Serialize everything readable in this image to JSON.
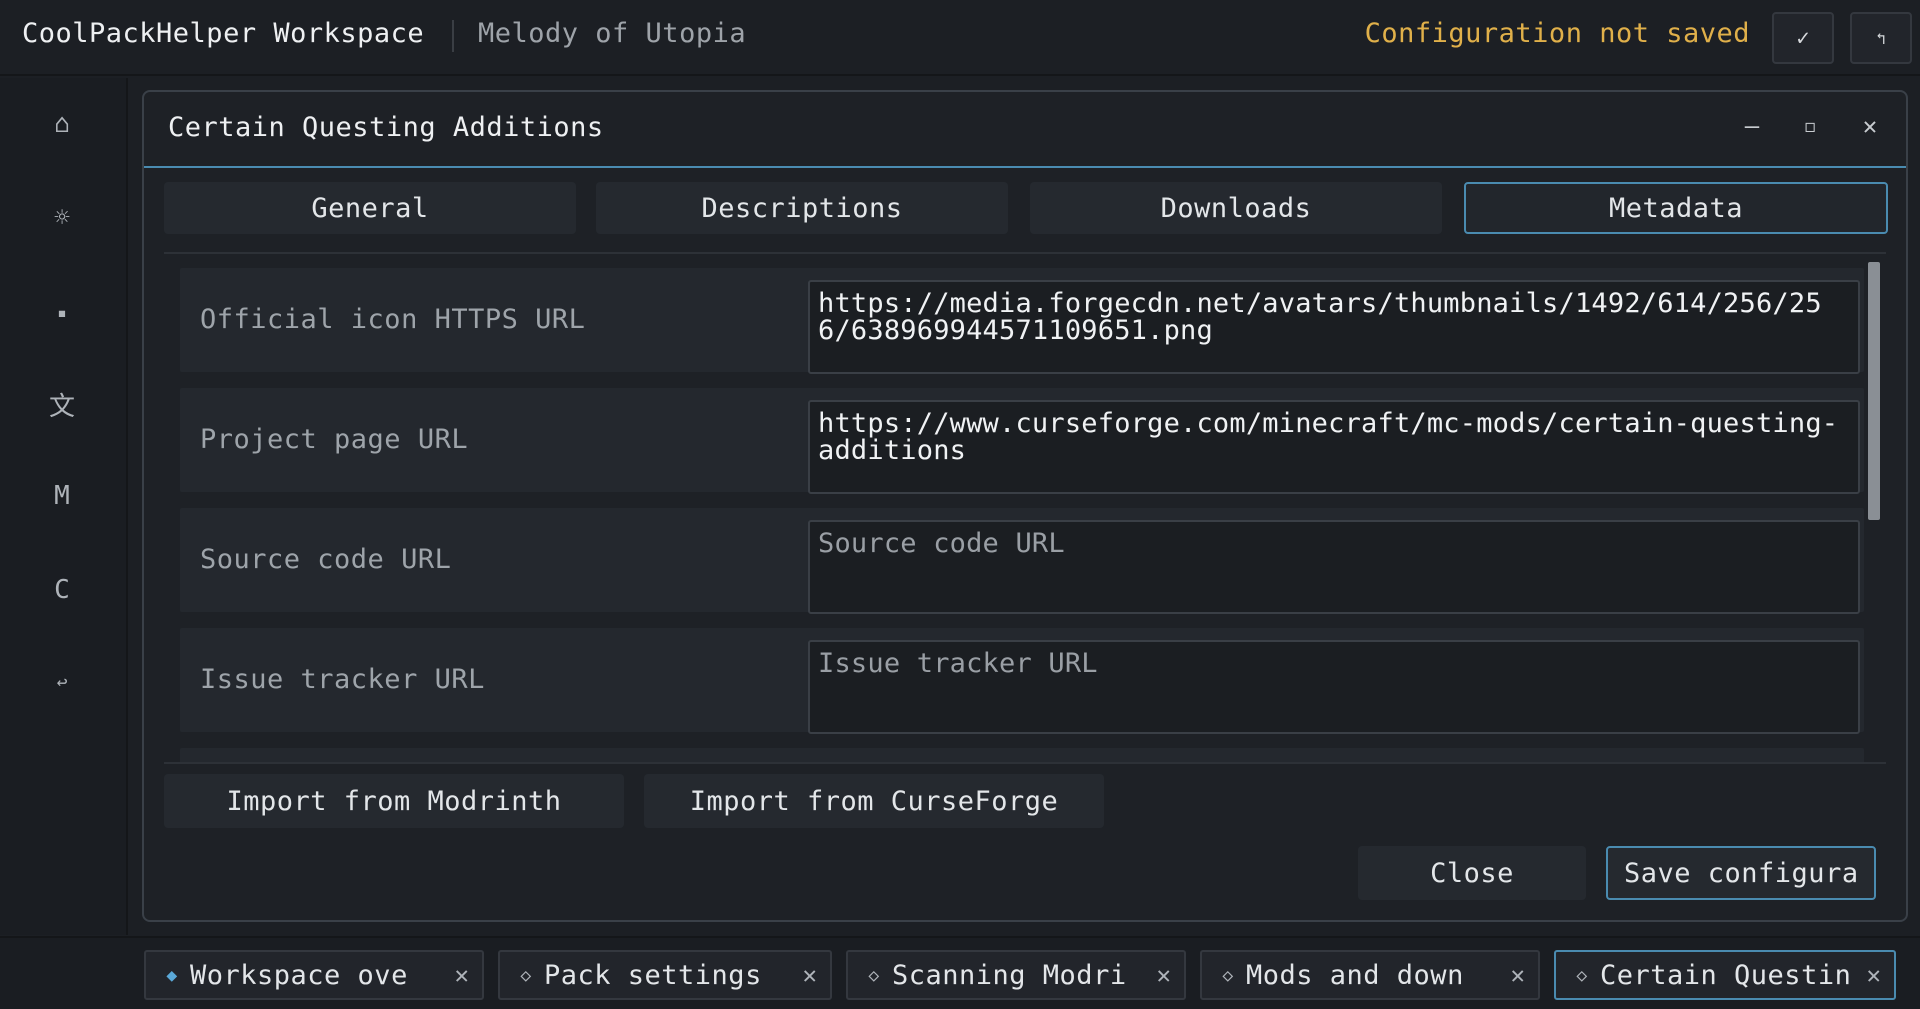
{
  "header": {
    "app_title": "CoolPackHelper Workspace",
    "pack_name": "Melody of Utopia",
    "status": "Configuration not saved",
    "confirm_icon": "✓",
    "revert_icon": "↰"
  },
  "sidebar": {
    "items": [
      {
        "icon": "⌂",
        "name": "home"
      },
      {
        "icon": "☼",
        "name": "settings"
      },
      {
        "icon": "▪",
        "name": "block"
      },
      {
        "icon": "文",
        "name": "translate"
      },
      {
        "icon": "M",
        "name": "modrinth"
      },
      {
        "icon": "C",
        "name": "curseforge"
      },
      {
        "icon": "↩",
        "name": "back"
      }
    ]
  },
  "dialog": {
    "title": "Certain Questing Additions",
    "controls": {
      "minimize": "—",
      "maximize": "◻",
      "close": "✕"
    },
    "tabs": [
      {
        "label": "General",
        "active": false
      },
      {
        "label": "Descriptions",
        "active": false
      },
      {
        "label": "Downloads",
        "active": false
      },
      {
        "label": "Metadata",
        "active": true
      }
    ],
    "fields": [
      {
        "label": "Official icon HTTPS URL",
        "value": "https://media.forgecdn.net/avatars/thumbnails/1492/614/256/256/638969944571109651.png",
        "placeholder": ""
      },
      {
        "label": "Project page URL",
        "value": "https://www.curseforge.com/minecraft/mc-mods/certain-questing-additions",
        "placeholder": ""
      },
      {
        "label": "Source code URL",
        "value": "",
        "placeholder": "Source code URL"
      },
      {
        "label": "Issue tracker URL",
        "value": "",
        "placeholder": "Issue tracker URL"
      }
    ],
    "import_modrinth": "Import from Modrinth",
    "import_curseforge": "Import from CurseForge",
    "close_label": "Close",
    "save_label": "Save configura"
  },
  "bottom_tabs": [
    {
      "label": "Workspace ove",
      "icon": "◆",
      "active": false
    },
    {
      "label": "Pack settings",
      "icon": "◇",
      "active": false
    },
    {
      "label": "Scanning Modri",
      "icon": "◇",
      "active": false
    },
    {
      "label": "Mods and down",
      "icon": "◇",
      "active": false
    },
    {
      "label": "Certain Questin",
      "icon": "◇",
      "active": true
    }
  ],
  "bottom_close_icon": "✕"
}
